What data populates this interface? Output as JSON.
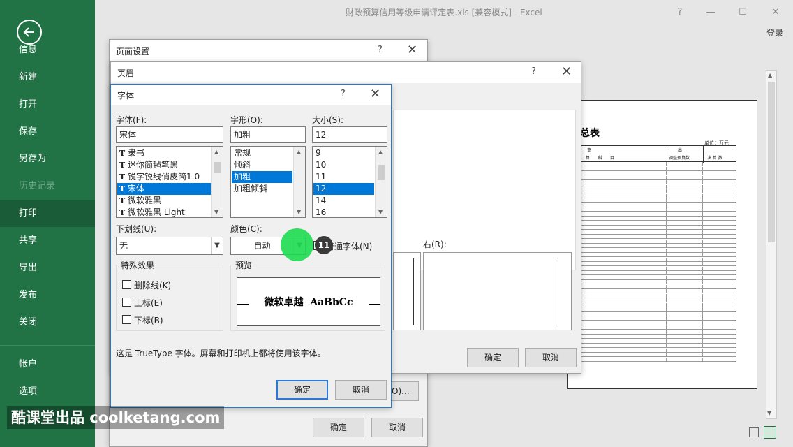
{
  "window": {
    "title": "财政预算信用等级申请评定表.xls  [兼容模式] - Excel",
    "help": "?",
    "minimize": "—",
    "maximize": "☐",
    "close": "✕",
    "login": "登录"
  },
  "nav": {
    "items": [
      {
        "label": "信息"
      },
      {
        "label": "新建"
      },
      {
        "label": "打开"
      },
      {
        "label": "保存"
      },
      {
        "label": "另存为"
      },
      {
        "label": "历史记录"
      },
      {
        "label": "打印"
      },
      {
        "label": "共享"
      },
      {
        "label": "导出"
      },
      {
        "label": "发布"
      },
      {
        "label": "关闭"
      },
      {
        "label": "帐户"
      },
      {
        "label": "选项"
      }
    ],
    "selected": "打印",
    "accent": "#217346"
  },
  "page_setup": {
    "title": "页面设置",
    "help": "?",
    "close": "✕",
    "ok": "确定",
    "cancel": "取消"
  },
  "header_dialog": {
    "title": "页眉",
    "help": "?",
    "close": "✕",
    "right_label": "右(R):",
    "ok": "确定",
    "cancel": "取消",
    "options_btn": "O)..."
  },
  "font_dialog": {
    "title": "字体",
    "help": "?",
    "close": "✕",
    "font_label": "字体(F):",
    "font_value": "宋体",
    "fonts": [
      "隶书",
      "迷你简毡笔黑",
      "锐字锐线俏皮简1.0",
      "宋体",
      "微软雅黑",
      "微软雅黑 Light"
    ],
    "font_selected": 3,
    "style_label": "字形(O):",
    "style_value": "加粗",
    "styles": [
      "常规",
      "倾斜",
      "加粗",
      "加粗倾斜"
    ],
    "style_selected": 2,
    "size_label": "大小(S):",
    "size_value": "12",
    "sizes": [
      "9",
      "10",
      "11",
      "12",
      "14",
      "16"
    ],
    "size_selected": 3,
    "underline_label": "下划线(U):",
    "underline_value": "无",
    "color_label": "颜色(C):",
    "color_value": "自动",
    "normal_font_label": "普通字体(N)",
    "effects_label": "特殊效果",
    "strike_label": "删除线(K)",
    "super_label": "上标(E)",
    "sub_label": "下标(B)",
    "preview_label": "预览",
    "preview_text": "微软卓越  AaBbCc",
    "info": "这是 TrueType 字体。屏幕和打印机上都将使用该字体。",
    "ok": "确定",
    "cancel": "取消"
  },
  "step_badge": "11",
  "watermark": "酷课堂出品 coolketang.com",
  "preview_sheet": {
    "title": "总表",
    "unit": "单位：万元",
    "head1": "支",
    "head2": "出",
    "col_a": "算      科      目",
    "col_b": "调整预算数",
    "col_c": "决 算 数"
  },
  "icons": [
    "back-arrow-icon",
    "grid-icon",
    "page-icon",
    "pointer-icon",
    "page-view-icon",
    "zoom-page-icon"
  ]
}
